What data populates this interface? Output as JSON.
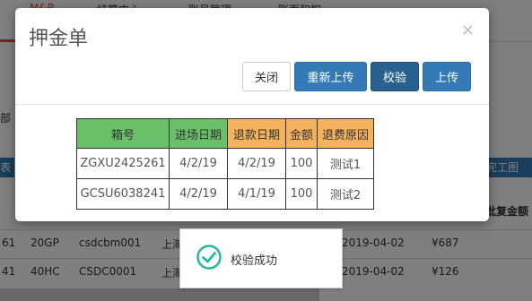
{
  "background": {
    "nav": [
      "M&R",
      "结算中心",
      "账号管理",
      "账面和权"
    ],
    "left_text": "部",
    "blue_left": "表",
    "blue_right": "传完工图",
    "right_header": "批复金额",
    "rows": [
      {
        "c1": "61",
        "c2": "20GP",
        "c3": "csdcbm001",
        "c4": "上海",
        "c5": "2019-04-02",
        "c6": "¥687"
      },
      {
        "c1": "41",
        "c2": "40HC",
        "c3": "CSDC0001",
        "c4": "上海",
        "c5": "2019-04-02",
        "c6": "¥126"
      }
    ]
  },
  "modal": {
    "title": "押金单",
    "close_icon": "close-icon",
    "buttons": {
      "close": "关闭",
      "reupload": "重新上传",
      "verify": "校验",
      "upload": "上传"
    },
    "table": {
      "headers": [
        "箱号",
        "进场日期",
        "退款日期",
        "金额",
        "退费原因"
      ],
      "header_colors": [
        "#6abf69",
        "#6abf69",
        "#f4b25e",
        "#f4b25e",
        "#f4b25e"
      ],
      "rows": [
        [
          "ZGXU2425261",
          "4/2/19",
          "4/2/19",
          "100",
          "测试1"
        ],
        [
          "GCSU6038241",
          "4/2/19",
          "4/1/19",
          "100",
          "测试2"
        ]
      ]
    }
  },
  "toast": {
    "icon": "check-circle-icon",
    "message": "校验成功",
    "accent": "#26b89a"
  }
}
